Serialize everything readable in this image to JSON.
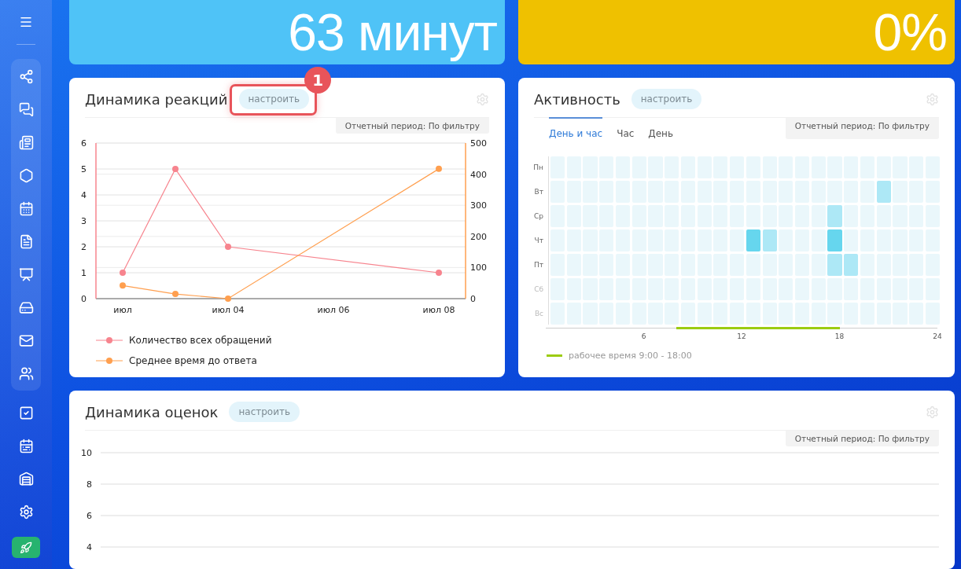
{
  "top_cards": [
    {
      "value": "63 минут",
      "color": "#4fc3f7"
    },
    {
      "value": "0%",
      "color": "#efc100"
    }
  ],
  "reactions": {
    "title": "Динамика реакций",
    "configure": {
      "label": "настроить",
      "highlighted": true,
      "callout": "1"
    },
    "period": "Отчетный период: По фильтру",
    "chart_data": {
      "type": "line",
      "grid": true,
      "categories": [
        "июл",
        null,
        "июл 04",
        null,
        "июл 06",
        null,
        "июл 08"
      ],
      "ylim": [
        0,
        6
      ],
      "yticks": [
        0,
        1,
        2,
        3,
        4,
        5,
        6
      ],
      "y2lim": [
        0,
        500
      ],
      "y2ticks": [
        0,
        100,
        200,
        300,
        400,
        500
      ],
      "series": [
        {
          "name": "Количество всех обращений",
          "color": "#f7848e",
          "values": [
            1,
            5,
            2,
            null,
            null,
            null,
            1
          ],
          "marker": "circle"
        },
        {
          "name": "Среднее время до ответа",
          "color": "#ff9f4f",
          "values": [
            42,
            15,
            0,
            null,
            null,
            null,
            417
          ],
          "axis": "y2",
          "marker": "circle"
        }
      ]
    }
  },
  "activity": {
    "title": "Активность",
    "configure": {
      "label": "настроить"
    },
    "period": "Отчетный период: По фильтру",
    "tabs": [
      {
        "label": "День и час",
        "selected": true
      },
      {
        "label": "Час",
        "selected": false
      },
      {
        "label": "День",
        "selected": false
      }
    ],
    "rows": [
      {
        "label": "Пн",
        "dimmed": false,
        "cells": [
          {
            "color": "#eaf7fb"
          },
          {
            "color": "#eaf7fb"
          },
          {
            "color": "#eaf7fb"
          },
          {
            "color": "#eaf7fb"
          },
          {
            "color": "#eaf7fb"
          },
          {
            "color": "#eaf7fb"
          },
          {
            "color": "#eaf7fb"
          },
          {
            "color": "#eaf7fb"
          },
          {
            "color": "#eaf7fb"
          },
          {
            "color": "#eaf7fb"
          },
          {
            "color": "#eaf7fb"
          },
          {
            "color": "#eaf7fb"
          },
          {
            "color": "#eaf7fb"
          },
          {
            "color": "#eaf7fb"
          },
          {
            "color": "#eaf7fb"
          },
          {
            "color": "#eaf7fb"
          },
          {
            "color": "#eaf7fb"
          },
          {
            "color": "#eaf7fb"
          },
          {
            "color": "#eaf7fb"
          },
          {
            "color": "#eaf7fb"
          },
          {
            "color": "#eaf7fb"
          },
          {
            "color": "#eaf7fb"
          },
          {
            "color": "#eaf7fb"
          },
          {
            "color": "#eaf7fb"
          }
        ]
      },
      {
        "label": "Вт",
        "dimmed": false,
        "cells": [
          {
            "color": "#eaf7fb"
          },
          {
            "color": "#eaf7fb"
          },
          {
            "color": "#eaf7fb"
          },
          {
            "color": "#eaf7fb"
          },
          {
            "color": "#eaf7fb"
          },
          {
            "color": "#eaf7fb"
          },
          {
            "color": "#eaf7fb"
          },
          {
            "color": "#eaf7fb"
          },
          {
            "color": "#eaf7fb"
          },
          {
            "color": "#eaf7fb"
          },
          {
            "color": "#eaf7fb"
          },
          {
            "color": "#eaf7fb"
          },
          {
            "color": "#eaf7fb"
          },
          {
            "color": "#eaf7fb"
          },
          {
            "color": "#eaf7fb"
          },
          {
            "color": "#eaf7fb"
          },
          {
            "color": "#eaf7fb"
          },
          {
            "color": "#eaf7fb"
          },
          {
            "color": "#eaf7fb"
          },
          {
            "color": "#eaf7fb"
          },
          {
            "color": "#ade8f6"
          },
          {
            "color": "#eaf7fb"
          },
          {
            "color": "#eaf7fb"
          },
          {
            "color": "#eaf7fb"
          }
        ]
      },
      {
        "label": "Ср",
        "dimmed": false,
        "cells": [
          {
            "color": "#eaf7fb"
          },
          {
            "color": "#eaf7fb"
          },
          {
            "color": "#eaf7fb"
          },
          {
            "color": "#eaf7fb"
          },
          {
            "color": "#eaf7fb"
          },
          {
            "color": "#eaf7fb"
          },
          {
            "color": "#eaf7fb"
          },
          {
            "color": "#eaf7fb"
          },
          {
            "color": "#eaf7fb"
          },
          {
            "color": "#eaf7fb"
          },
          {
            "color": "#eaf7fb"
          },
          {
            "color": "#eaf7fb"
          },
          {
            "color": "#eaf7fb"
          },
          {
            "color": "#eaf7fb"
          },
          {
            "color": "#eaf7fb"
          },
          {
            "color": "#eaf7fb"
          },
          {
            "color": "#eaf7fb"
          },
          {
            "color": "#ade8f6"
          },
          {
            "color": "#eaf7fb"
          },
          {
            "color": "#eaf7fb"
          },
          {
            "color": "#eaf7fb"
          },
          {
            "color": "#eaf7fb"
          },
          {
            "color": "#eaf7fb"
          },
          {
            "color": "#eaf7fb"
          }
        ]
      },
      {
        "label": "Чт",
        "dimmed": false,
        "cells": [
          {
            "color": "#eaf7fb"
          },
          {
            "color": "#eaf7fb"
          },
          {
            "color": "#eaf7fb"
          },
          {
            "color": "#eaf7fb"
          },
          {
            "color": "#eaf7fb"
          },
          {
            "color": "#eaf7fb"
          },
          {
            "color": "#eaf7fb"
          },
          {
            "color": "#eaf7fb"
          },
          {
            "color": "#eaf7fb"
          },
          {
            "color": "#eaf7fb"
          },
          {
            "color": "#eaf7fb"
          },
          {
            "color": "#eaf7fb"
          },
          {
            "color": "#66d6ee"
          },
          {
            "color": "#ade8f6"
          },
          {
            "color": "#eaf7fb"
          },
          {
            "color": "#eaf7fb"
          },
          {
            "color": "#eaf7fb"
          },
          {
            "color": "#66d6ee"
          },
          {
            "color": "#eaf7fb"
          },
          {
            "color": "#eaf7fb"
          },
          {
            "color": "#eaf7fb"
          },
          {
            "color": "#eaf7fb"
          },
          {
            "color": "#eaf7fb"
          },
          {
            "color": "#eaf7fb"
          }
        ]
      },
      {
        "label": "Пт",
        "dimmed": false,
        "cells": [
          {
            "color": "#eaf7fb"
          },
          {
            "color": "#eaf7fb"
          },
          {
            "color": "#eaf7fb"
          },
          {
            "color": "#eaf7fb"
          },
          {
            "color": "#eaf7fb"
          },
          {
            "color": "#eaf7fb"
          },
          {
            "color": "#eaf7fb"
          },
          {
            "color": "#eaf7fb"
          },
          {
            "color": "#eaf7fb"
          },
          {
            "color": "#eaf7fb"
          },
          {
            "color": "#eaf7fb"
          },
          {
            "color": "#eaf7fb"
          },
          {
            "color": "#eaf7fb"
          },
          {
            "color": "#eaf7fb"
          },
          {
            "color": "#eaf7fb"
          },
          {
            "color": "#eaf7fb"
          },
          {
            "color": "#eaf7fb"
          },
          {
            "color": "#ade8f6"
          },
          {
            "color": "#ade8f6"
          },
          {
            "color": "#eaf7fb"
          },
          {
            "color": "#eaf7fb"
          },
          {
            "color": "#eaf7fb"
          },
          {
            "color": "#eaf7fb"
          },
          {
            "color": "#eaf7fb"
          }
        ]
      },
      {
        "label": "Сб",
        "dimmed": true,
        "cells": [
          {
            "color": "#eaf7fb"
          },
          {
            "color": "#eaf7fb"
          },
          {
            "color": "#eaf7fb"
          },
          {
            "color": "#eaf7fb"
          },
          {
            "color": "#eaf7fb"
          },
          {
            "color": "#eaf7fb"
          },
          {
            "color": "#eaf7fb"
          },
          {
            "color": "#eaf7fb"
          },
          {
            "color": "#eaf7fb"
          },
          {
            "color": "#eaf7fb"
          },
          {
            "color": "#eaf7fb"
          },
          {
            "color": "#eaf7fb"
          },
          {
            "color": "#eaf7fb"
          },
          {
            "color": "#eaf7fb"
          },
          {
            "color": "#eaf7fb"
          },
          {
            "color": "#eaf7fb"
          },
          {
            "color": "#eaf7fb"
          },
          {
            "color": "#eaf7fb"
          },
          {
            "color": "#eaf7fb"
          },
          {
            "color": "#eaf7fb"
          },
          {
            "color": "#eaf7fb"
          },
          {
            "color": "#eaf7fb"
          },
          {
            "color": "#eaf7fb"
          },
          {
            "color": "#eaf7fb"
          }
        ]
      },
      {
        "label": "Вс",
        "dimmed": true,
        "cells": [
          {
            "color": "#eaf7fb"
          },
          {
            "color": "#eaf7fb"
          },
          {
            "color": "#eaf7fb"
          },
          {
            "color": "#eaf7fb"
          },
          {
            "color": "#eaf7fb"
          },
          {
            "color": "#eaf7fb"
          },
          {
            "color": "#eaf7fb"
          },
          {
            "color": "#eaf7fb"
          },
          {
            "color": "#eaf7fb"
          },
          {
            "color": "#eaf7fb"
          },
          {
            "color": "#eaf7fb"
          },
          {
            "color": "#eaf7fb"
          },
          {
            "color": "#eaf7fb"
          },
          {
            "color": "#eaf7fb"
          },
          {
            "color": "#eaf7fb"
          },
          {
            "color": "#eaf7fb"
          },
          {
            "color": "#eaf7fb"
          },
          {
            "color": "#eaf7fb"
          },
          {
            "color": "#eaf7fb"
          },
          {
            "color": "#eaf7fb"
          },
          {
            "color": "#eaf7fb"
          },
          {
            "color": "#eaf7fb"
          },
          {
            "color": "#eaf7fb"
          },
          {
            "color": "#eaf7fb"
          }
        ]
      }
    ],
    "hour_ticks": [
      "6",
      "12",
      "18",
      "24"
    ],
    "legend": "рабочее время 9:00 - 18:00"
  },
  "ratings": {
    "title": "Динамика оценок",
    "configure": {
      "label": "настроить"
    },
    "period": "Отчетный период: По фильтру",
    "chart_data": {
      "type": "line",
      "categories": [
        null
      ],
      "grid": true,
      "ylim": [
        4,
        10
      ],
      "yticks": [
        4,
        6,
        8,
        10
      ]
    }
  }
}
